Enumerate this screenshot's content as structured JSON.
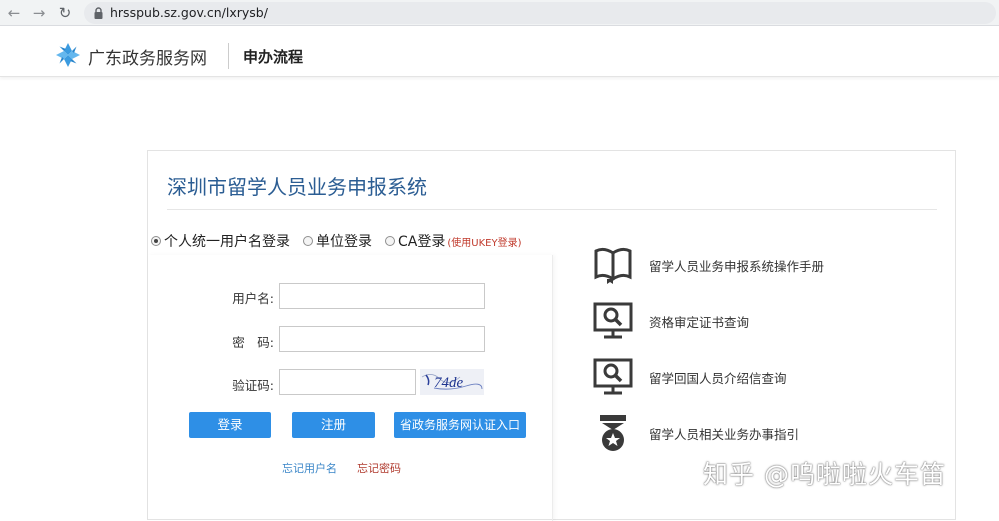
{
  "browser": {
    "url": "hrsspub.sz.gov.cn/lxrysb/",
    "back_icon": "arrow-left-icon",
    "forward_icon": "arrow-right-icon",
    "reload_icon": "reload-icon"
  },
  "header": {
    "site_name": "广东政务服务网",
    "page_name": "申办流程"
  },
  "panel": {
    "title": "深圳市留学人员业务申报系统",
    "login_options": [
      {
        "label": "个人统一用户名登录",
        "selected": true
      },
      {
        "label": "单位登录",
        "selected": false
      },
      {
        "label": "CA登录",
        "selected": false
      }
    ],
    "ukey_note": "(使用UKEY登录)",
    "form": {
      "username_label": "用户名:",
      "password_label": "密　码:",
      "captcha_label": "验证码:",
      "captcha_text": "74de",
      "username_value": "",
      "password_value": "",
      "captcha_value": ""
    },
    "buttons": {
      "login": "登录",
      "register": "注册",
      "gov_portal": "省政务服务网认证入口"
    },
    "links": {
      "forgot_username": "忘记用户名",
      "forgot_password": "忘记密码"
    }
  },
  "side_links": [
    {
      "label": "留学人员业务申报系统操作手册",
      "icon": "book-icon"
    },
    {
      "label": "资格审定证书查询",
      "icon": "monitor-search-icon"
    },
    {
      "label": "留学回国人员介绍信查询",
      "icon": "monitor-search-icon"
    },
    {
      "label": "留学人员相关业务办事指引",
      "icon": "award-badge-icon"
    }
  ],
  "watermark": "知乎 @呜啦啦火车笛",
  "colors": {
    "title_blue": "#2b5d93",
    "button_blue": "#2e8fe6",
    "link_blue": "#3a86c8",
    "link_red": "#b03a2e",
    "note_red": "#c0392b",
    "logo_blue": "#3b9be0"
  }
}
